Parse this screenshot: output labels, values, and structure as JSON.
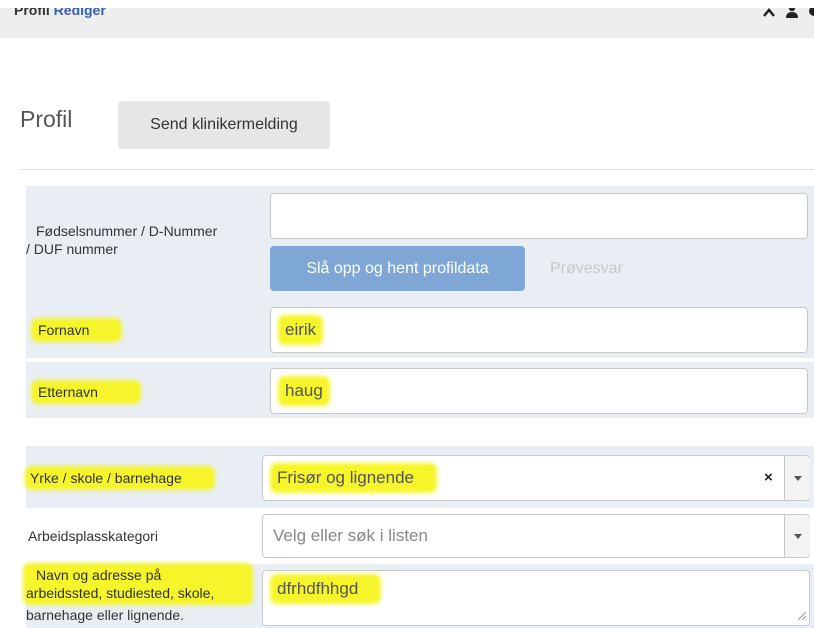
{
  "topbar": {
    "title": "Profil",
    "edit": "Rediger",
    "icons": [
      "chevron-up-icon",
      "user-icon",
      "more-icon"
    ]
  },
  "page": {
    "title": "Profil",
    "send_button": "Send klinikermelding"
  },
  "form": {
    "id_number": {
      "label_line1": "Fødselsnummer / D-Nummer",
      "label_line2": "/ DUF nummer",
      "value": "",
      "lookup_button": "Slå opp og hent profildata",
      "test_link": "Prøvesvar"
    },
    "first_name": {
      "label": "Fornavn",
      "value": "eirik"
    },
    "last_name": {
      "label": "Etternavn",
      "value": "haug"
    },
    "occupation": {
      "label": "Yrke / skole / barnehage",
      "value": "Frisør og lignende",
      "clear": "×"
    },
    "workplace_category": {
      "label": "Arbeidsplasskategori",
      "placeholder": "Velg eller søk i listen"
    },
    "address": {
      "label_line1": "Navn og adresse på",
      "label_line2": "arbeidssted, studiested, skole,",
      "label_line3": "barnehage eller lignende.",
      "value": "dfrhdfhhgd"
    }
  },
  "highlight_color": "#f5f52a"
}
